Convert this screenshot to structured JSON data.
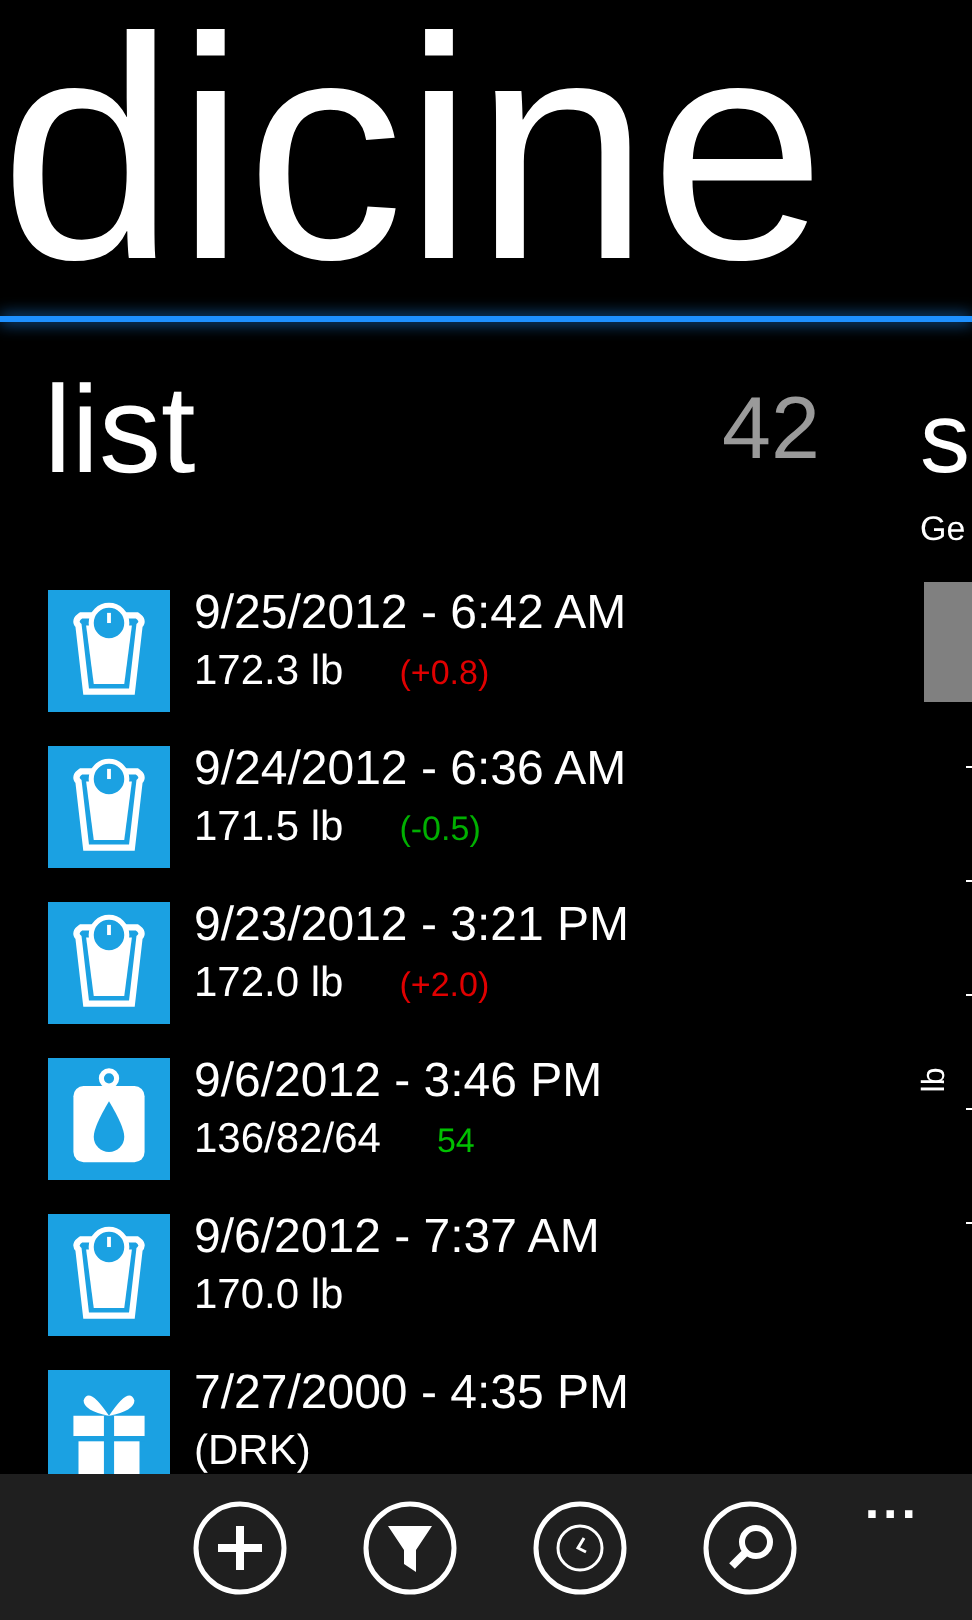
{
  "app_title": "dicine",
  "list_panel": {
    "title": "list",
    "count": "42",
    "items": [
      {
        "kind": "scale",
        "datetime": "9/25/2012 - 6:42 AM",
        "value": "172.3 lb",
        "delta": "(+0.8)",
        "color": "#e00000"
      },
      {
        "kind": "scale",
        "datetime": "9/24/2012 - 6:36 AM",
        "value": "171.5 lb",
        "delta": "(-0.5)",
        "color": "#00b000"
      },
      {
        "kind": "scale",
        "datetime": "9/23/2012 - 3:21 PM",
        "value": "172.0 lb",
        "delta": "(+2.0)",
        "color": "#e00000"
      },
      {
        "kind": "blood",
        "datetime": "9/6/2012 - 3:46 PM",
        "value": "136/82/64",
        "delta": "54",
        "color": "#00c000"
      },
      {
        "kind": "scale",
        "datetime": "9/6/2012 - 7:37 AM",
        "value": "170.0 lb"
      },
      {
        "kind": "gift",
        "datetime": "7/27/2000 - 4:35 PM",
        "value": "(DRK)"
      }
    ]
  },
  "next_panel": {
    "title": "s",
    "subtitle": "Ge",
    "axis_label": "lb"
  },
  "app_bar": {
    "buttons": [
      {
        "kind": "add"
      },
      {
        "kind": "filter"
      },
      {
        "kind": "clock"
      },
      {
        "kind": "search"
      }
    ],
    "more": "..."
  }
}
